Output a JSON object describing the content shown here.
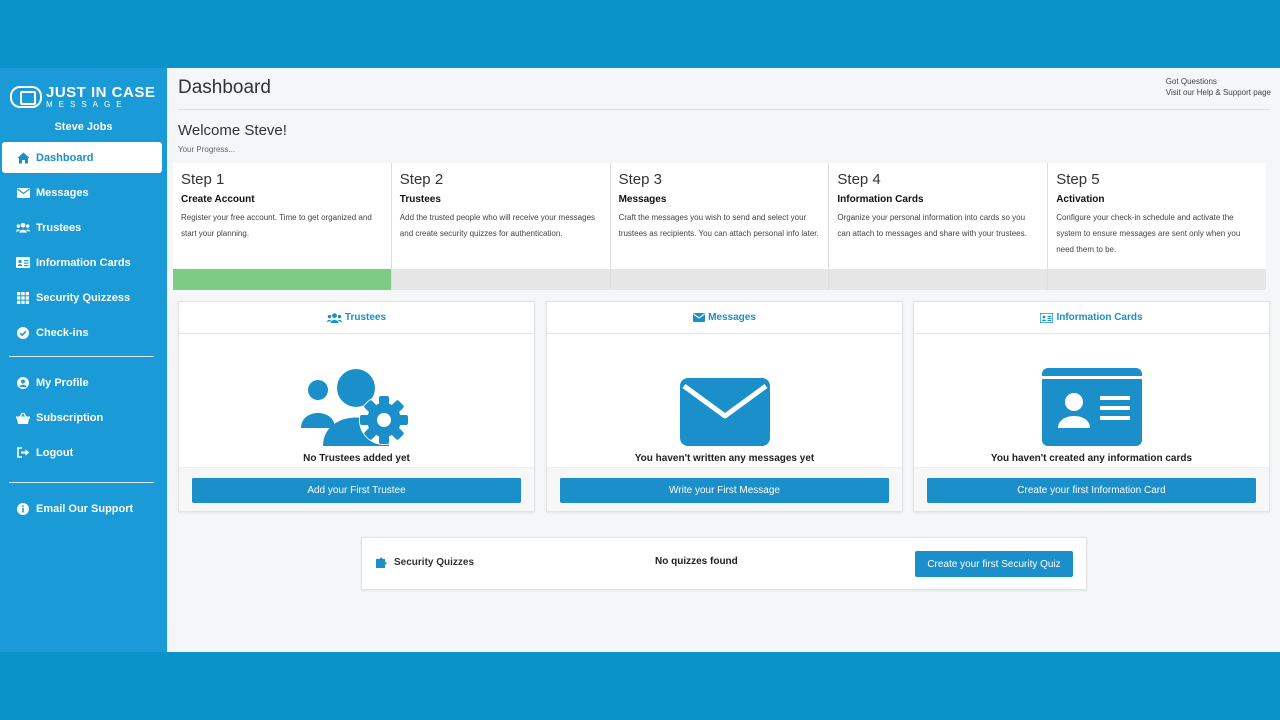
{
  "brand": {
    "name": "JUST IN CASE",
    "sub": "MESSAGE"
  },
  "user": {
    "name": "Steve Jobs"
  },
  "sidebar": {
    "items": [
      {
        "label": "Dashboard",
        "icon": "home-icon"
      },
      {
        "label": "Messages",
        "icon": "envelope-icon"
      },
      {
        "label": "Trustees",
        "icon": "users-icon"
      },
      {
        "label": "Information Cards",
        "icon": "id-card-icon"
      },
      {
        "label": "Security Quizzess",
        "icon": "grid-icon"
      },
      {
        "label": "Check-ins",
        "icon": "check-circle-icon"
      }
    ],
    "account": [
      {
        "label": "My Profile",
        "icon": "user-circle-icon"
      },
      {
        "label": "Subscription",
        "icon": "basket-icon"
      },
      {
        "label": "Logout",
        "icon": "logout-icon"
      }
    ],
    "support": {
      "label": "Email Our Support",
      "icon": "info-icon"
    }
  },
  "header": {
    "title": "Dashboard",
    "help_line1": "Got Questions",
    "help_line2": "Visit our Help & Support page"
  },
  "welcome": {
    "title": "Welcome Steve!",
    "progress_label": "Your Progress..."
  },
  "steps": [
    {
      "title": "Step 1",
      "subtitle": "Create Account",
      "desc": "Register your free account. Time to get organized and start your planning.",
      "progress": 1
    },
    {
      "title": "Step 2",
      "subtitle": "Trustees",
      "desc": "Add the trusted people who will receive your messages and create security quizzes for authentication.",
      "progress": 0
    },
    {
      "title": "Step 3",
      "subtitle": "Messages",
      "desc": "Craft the messages you wish to send and select your trustees as recipients. You can attach personal info later.",
      "progress": 0
    },
    {
      "title": "Step 4",
      "subtitle": "Information Cards",
      "desc": "Organize your personal information into cards so you can attach to messages and share with your trustees.",
      "progress": 0
    },
    {
      "title": "Step 5",
      "subtitle": "Activation",
      "desc": "Configure your check-in schedule and activate the system to ensure messages are sent only when you need them to be.",
      "progress": 0
    }
  ],
  "cards": {
    "trustees": {
      "title": "Trustees",
      "message": "No Trustees added yet",
      "button": "Add your First Trustee"
    },
    "messages": {
      "title": "Messages",
      "message": "You haven't written any messages yet",
      "button": "Write your First Message"
    },
    "info": {
      "title": "Information Cards",
      "message": "You haven't created any information cards",
      "button": "Create your first Information Card"
    }
  },
  "quiz": {
    "label": "Security Quizzes",
    "empty": "No quizzes found",
    "button": "Create your first Security Quiz"
  },
  "colors": {
    "accent": "#1a8fc9",
    "sidebar": "#1a9ad6",
    "progress_done": "#7ecb86",
    "frame": "#0a93c9"
  }
}
